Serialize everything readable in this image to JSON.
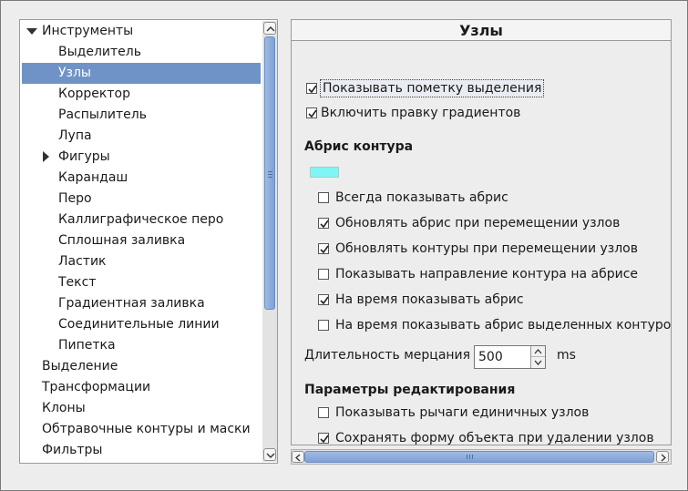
{
  "tree": {
    "items": [
      {
        "label": "Инструменты",
        "level": 0,
        "expander": "expanded"
      },
      {
        "label": "Выделитель",
        "level": 1
      },
      {
        "label": "Узлы",
        "level": 1,
        "selected": true
      },
      {
        "label": "Корректор",
        "level": 1
      },
      {
        "label": "Распылитель",
        "level": 1
      },
      {
        "label": "Лупа",
        "level": 1
      },
      {
        "label": "Фигуры",
        "level": 1,
        "expander": "collapsed"
      },
      {
        "label": "Карандаш",
        "level": 1
      },
      {
        "label": "Перо",
        "level": 1
      },
      {
        "label": "Каллиграфическое перо",
        "level": 1
      },
      {
        "label": "Сплошная заливка",
        "level": 1
      },
      {
        "label": "Ластик",
        "level": 1
      },
      {
        "label": "Текст",
        "level": 1
      },
      {
        "label": "Градиентная заливка",
        "level": 1
      },
      {
        "label": "Соединительные линии",
        "level": 1
      },
      {
        "label": "Пипетка",
        "level": 1
      },
      {
        "label": "Выделение",
        "level": 0
      },
      {
        "label": "Трансформации",
        "level": 0
      },
      {
        "label": "Клоны",
        "level": 0
      },
      {
        "label": "Обтравочные контуры и маски",
        "level": 0
      },
      {
        "label": "Фильтры",
        "level": 0
      }
    ]
  },
  "panel": {
    "title": "Узлы",
    "show_selection_cue": {
      "label": "Показывать пометку выделения",
      "checked": true
    },
    "enable_gradient_editing": {
      "label": "Включить правку градиентов",
      "checked": true
    },
    "path_outline": {
      "title": "Абрис контура",
      "color": "#7ff6f6",
      "options": [
        {
          "label": "Всегда показывать абрис",
          "checked": false
        },
        {
          "label": "Обновлять абрис при перемещении узлов",
          "checked": true
        },
        {
          "label": "Обновлять контуры при перемещении узлов",
          "checked": true
        },
        {
          "label": "Показывать направление контура на абрисе",
          "checked": false
        },
        {
          "label": "На время показывать абрис",
          "checked": true
        },
        {
          "label": "На время показывать абрис выделенных контуров",
          "checked": false
        }
      ]
    },
    "flash_time": {
      "label": "Длительность мерцания",
      "value": "500",
      "unit": "ms"
    },
    "editing": {
      "title": "Параметры редактирования",
      "options": [
        {
          "label": "Показывать рычаги единичных узлов",
          "checked": false
        },
        {
          "label": "Сохранять форму объекта при удалении узлов",
          "checked": true
        }
      ]
    }
  },
  "colors": {
    "selection": "#6f93c6",
    "scroll_thumb": "#8fb0dd"
  }
}
